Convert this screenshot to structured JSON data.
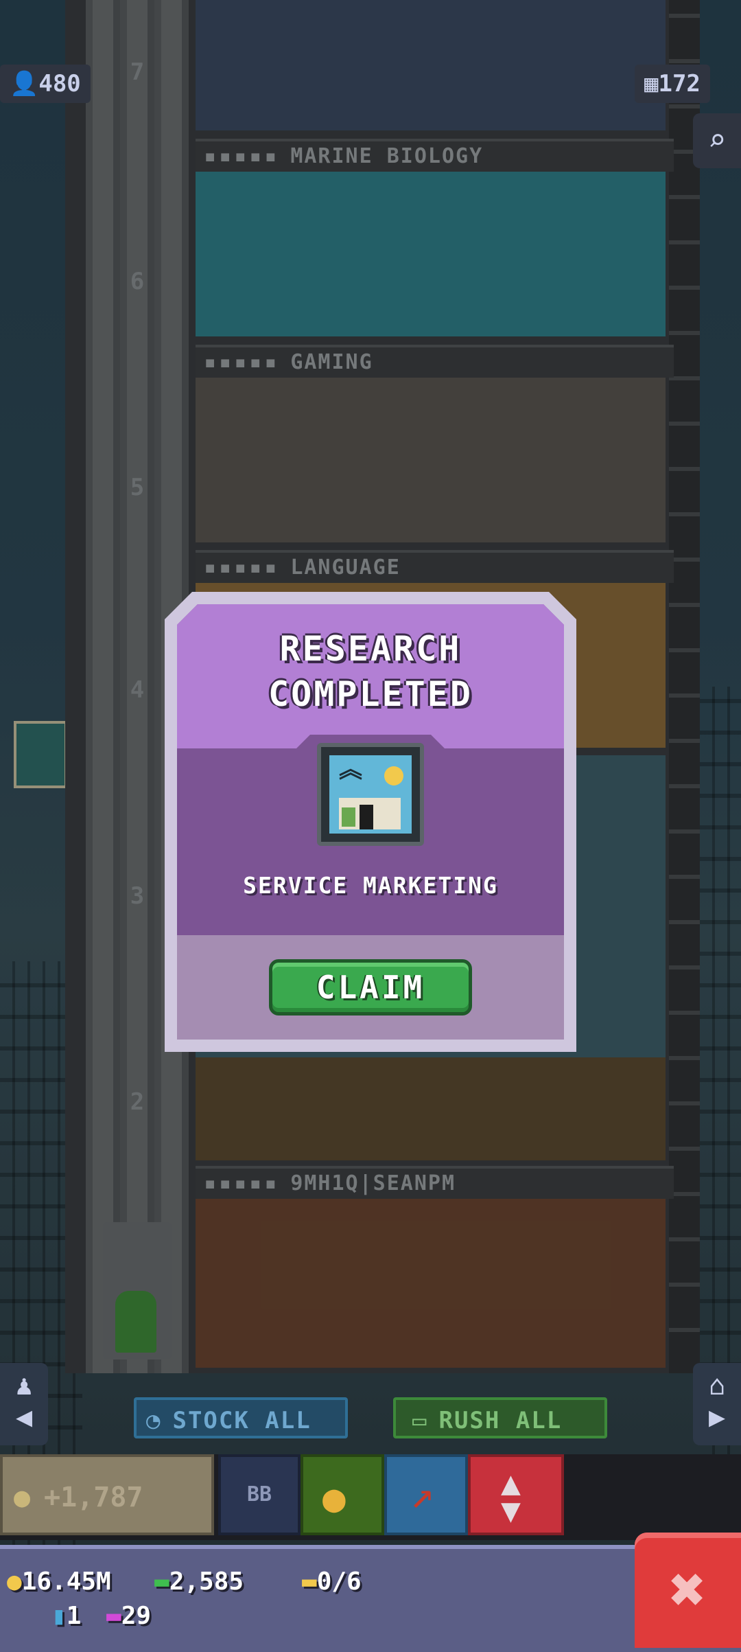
{
  "hud": {
    "population": "480",
    "floors_count": "172"
  },
  "elevator_floor_numbers": [
    "7",
    "6",
    "5",
    "4",
    "3",
    "2"
  ],
  "floors": [
    {
      "label": "MARINE BIOLOGY",
      "room_color": "#2f7f8a"
    },
    {
      "label": "GAMING",
      "room_color": "#5a5650"
    },
    {
      "label": "LANGUAGE",
      "room_color": "#8a6a3a"
    },
    {
      "label": "9MH1Q|SEANPM",
      "room_color": "#6a4530"
    }
  ],
  "floor_label_dots": "▪▪▪▪▪",
  "modal": {
    "title_line1": "RESEARCH",
    "title_line2": "COMPLETED",
    "research_name": "SERVICE MARKETING",
    "icon": "service-marketing-icon",
    "claim_label": "CLAIM"
  },
  "actions": {
    "stock_all": "STOCK ALL",
    "rush_all": "RUSH ALL"
  },
  "toolbar": {
    "coins_label": "+1,787",
    "bitbook_label": "BB"
  },
  "resources": {
    "coins": "16.45M",
    "bux": "2,585",
    "golden_tickets": "0/6",
    "keys": "1",
    "vip": "29"
  },
  "colors": {
    "modal_header": "#b27fd4",
    "modal_body": "#7c5494",
    "claim_green": "#3aa94e",
    "close_red": "#e03b3b"
  }
}
